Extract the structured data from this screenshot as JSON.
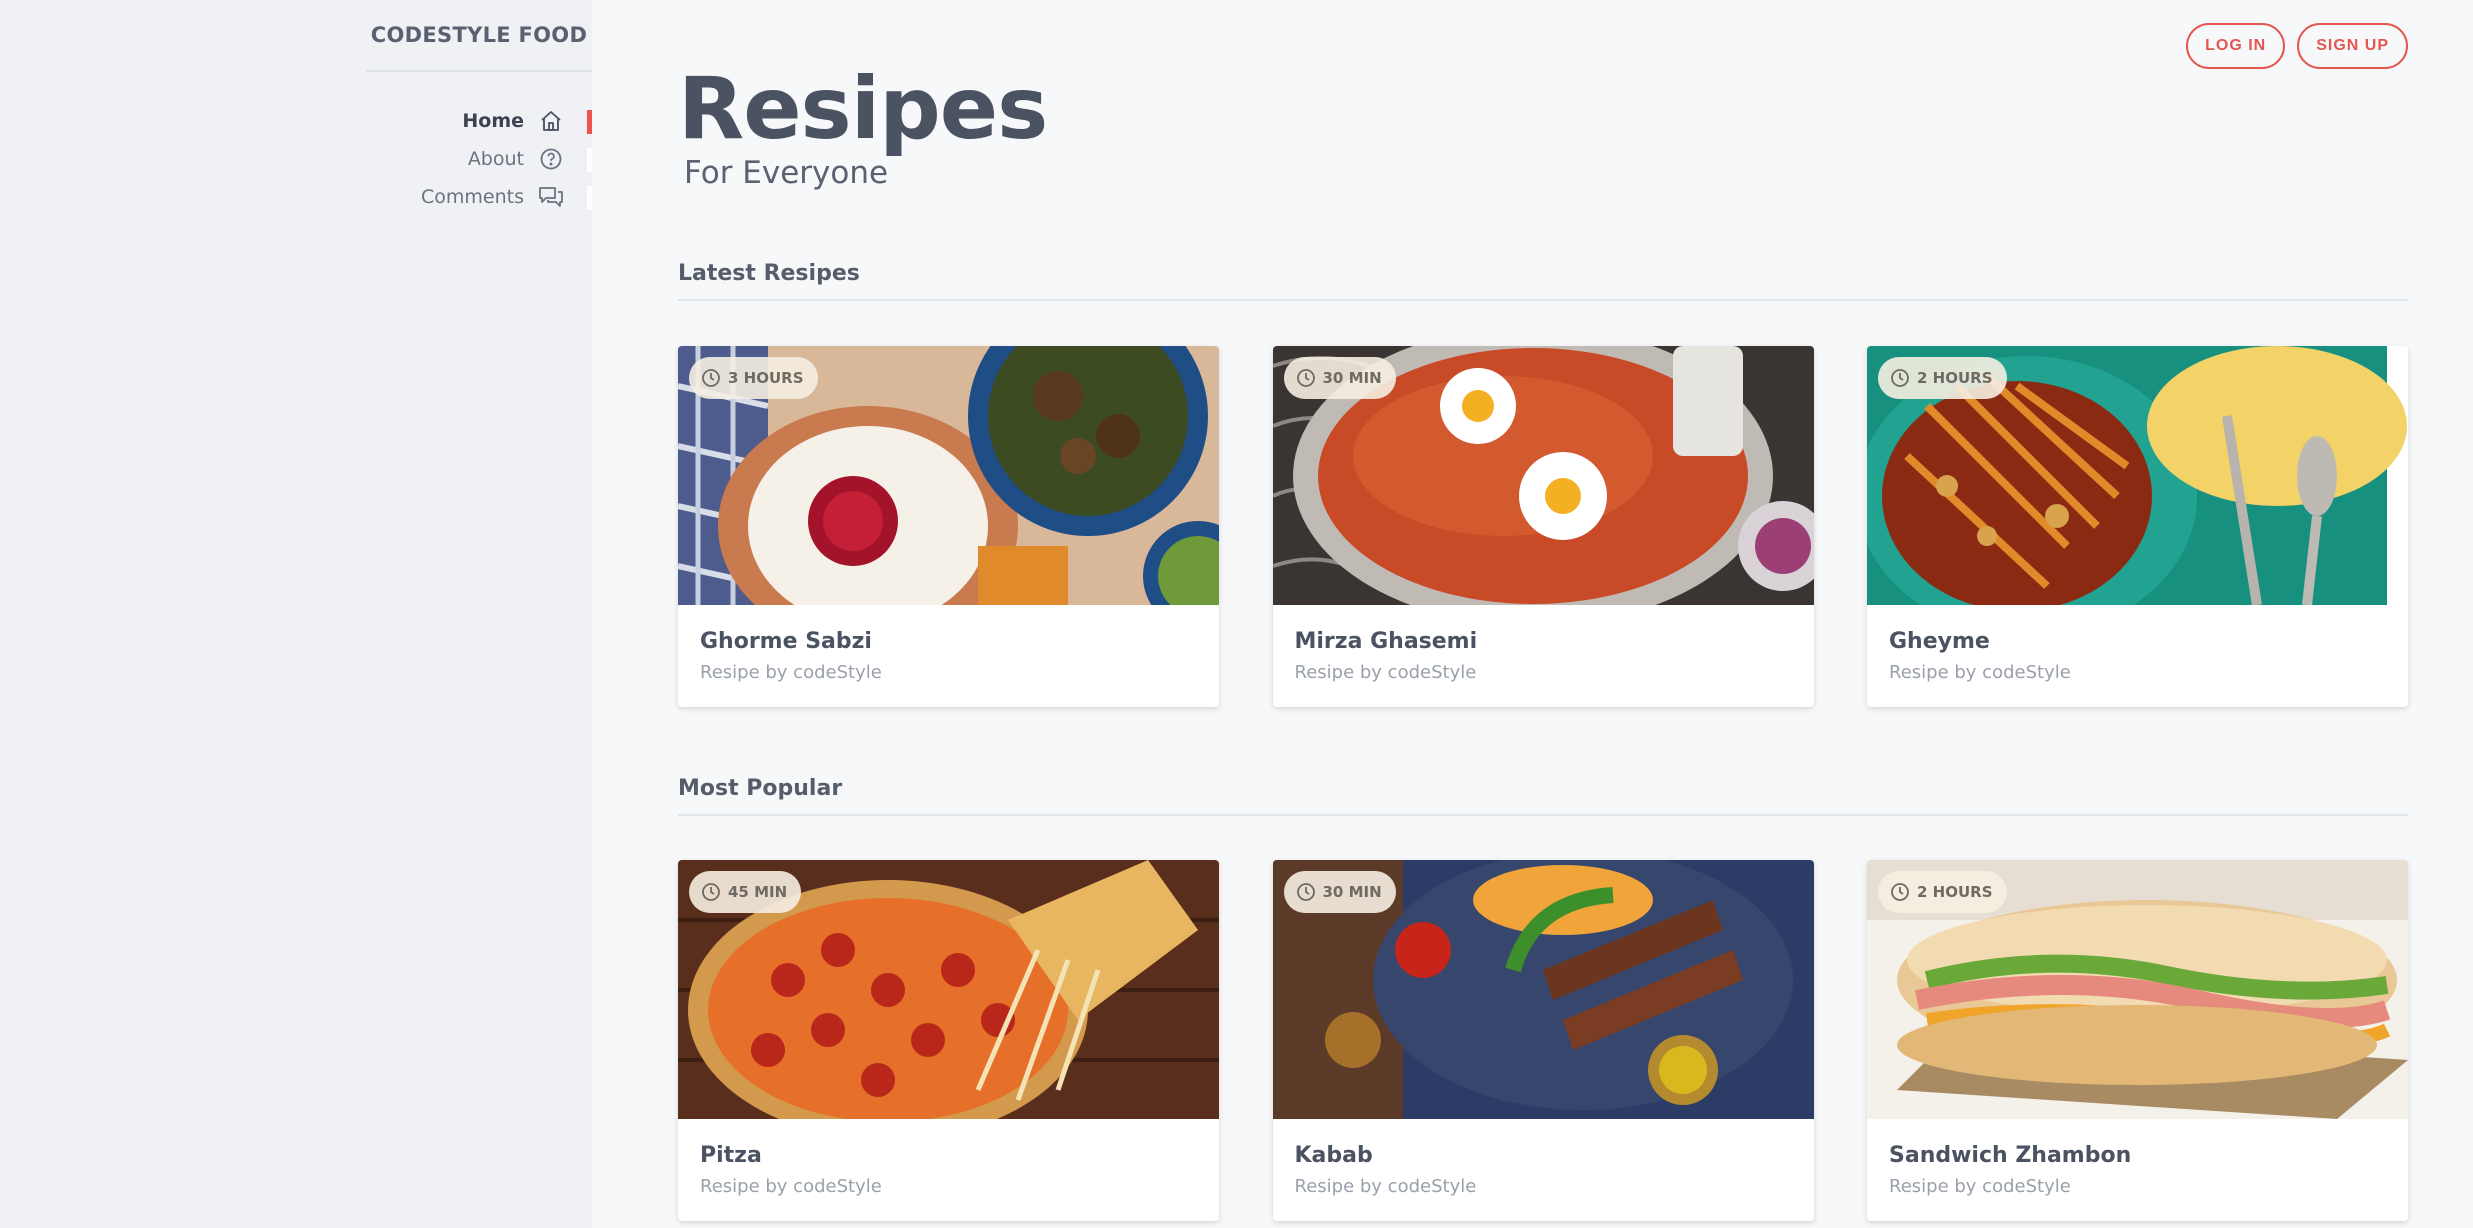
{
  "brand": "CODESTYLE FOOD",
  "nav": [
    {
      "label": "Home",
      "icon": "home-icon",
      "active": true
    },
    {
      "label": "About",
      "icon": "question-icon",
      "active": false
    },
    {
      "label": "Comments",
      "icon": "comments-icon",
      "active": false
    }
  ],
  "auth": {
    "login": "LOG IN",
    "signup": "SIGN UP"
  },
  "hero": {
    "title": "Resipes",
    "subtitle": "For Everyone"
  },
  "sections": [
    {
      "title": "Latest Resipes",
      "cards": [
        {
          "time": "3 HOURS",
          "name": "Ghorme Sabzi",
          "by": "Resipe by codeStyle"
        },
        {
          "time": "30 MIN",
          "name": "Mirza Ghasemi",
          "by": "Resipe by codeStyle"
        },
        {
          "time": "2 HOURS",
          "name": "Gheyme",
          "by": "Resipe by codeStyle"
        }
      ]
    },
    {
      "title": "Most Popular",
      "cards": [
        {
          "time": "45 MIN",
          "name": "Pitza",
          "by": "Resipe by codeStyle"
        },
        {
          "time": "30 MIN",
          "name": "Kabab",
          "by": "Resipe by codeStyle"
        },
        {
          "time": "2 HOURS",
          "name": "Sandwich Zhambon",
          "by": "Resipe by codeStyle"
        }
      ]
    }
  ],
  "colors": {
    "accent": "#e4574f",
    "sidebar": "#eff1f4",
    "background": "#f7f8fa"
  }
}
